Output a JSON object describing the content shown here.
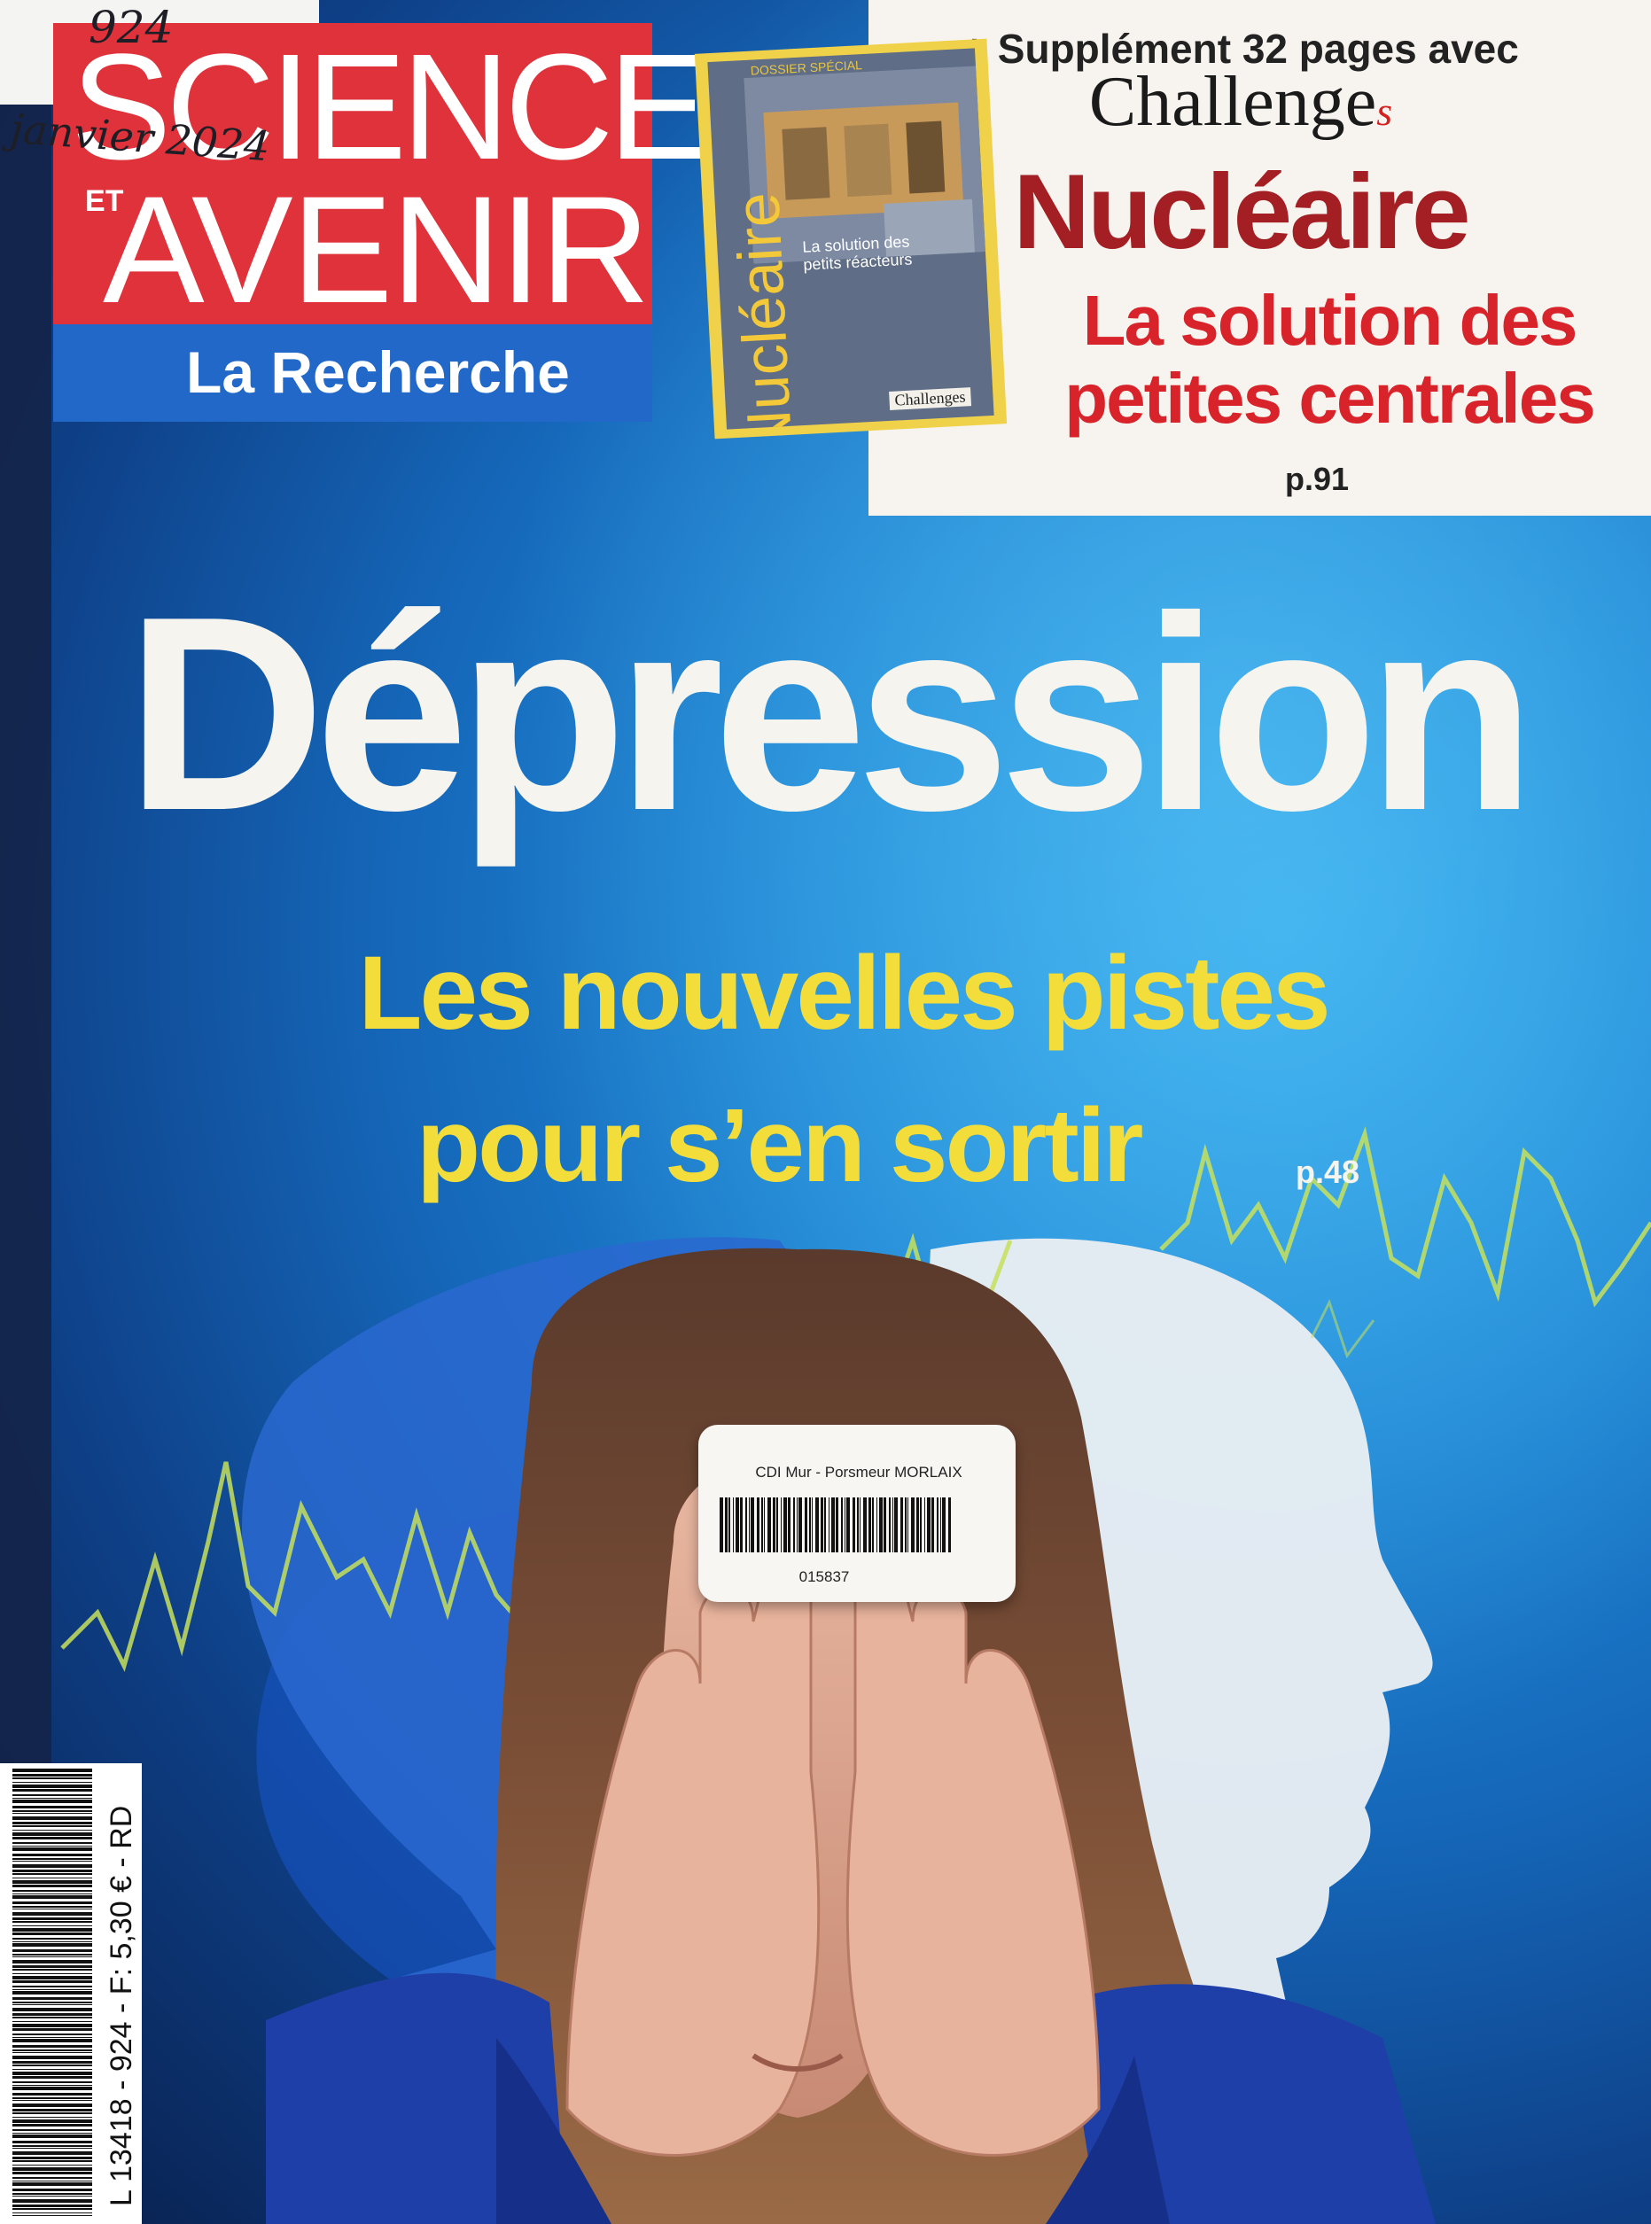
{
  "handwritten": {
    "issue": "924",
    "date": "janvier 2024"
  },
  "masthead": {
    "line1": "SCIENCES",
    "et": "ET",
    "line2": "AVENIR",
    "subtitle": "La Recherche"
  },
  "supplement": {
    "intro": "+ Supplément 32 pages avec",
    "brand": "Challenge",
    "brand_suffix": "s",
    "title": "Nucléaire",
    "subtitle_1": "La solution des",
    "subtitle_2": "petites centrales",
    "page": "p.91",
    "thumbnail": {
      "kicker": "DOSSIER SPÉCIAL",
      "title": "Nucléaire",
      "subtitle": "La solution des petits réacteurs",
      "brand": "Challenges"
    }
  },
  "headline": "Dépression",
  "subheadline_1": "Les nouvelles pistes",
  "subheadline_2": "pour s’en sortir",
  "subheadline_page": "p.48",
  "library_label": {
    "owner": "CDI Mur - Porsmeur MORLAIX",
    "number": "015837"
  },
  "spine": {
    "price_code": "L 13418 - 924 - F: 5,30 € - RD"
  },
  "colors": {
    "mast_red": "#e0323a",
    "mast_blue": "#2168c8",
    "headline_white": "#f5f4ee",
    "subheadline_yellow": "#f2dd3b",
    "supplement_title": "#a31f24",
    "supplement_red": "#d8232a",
    "cover_blue": "#1e86d4"
  }
}
